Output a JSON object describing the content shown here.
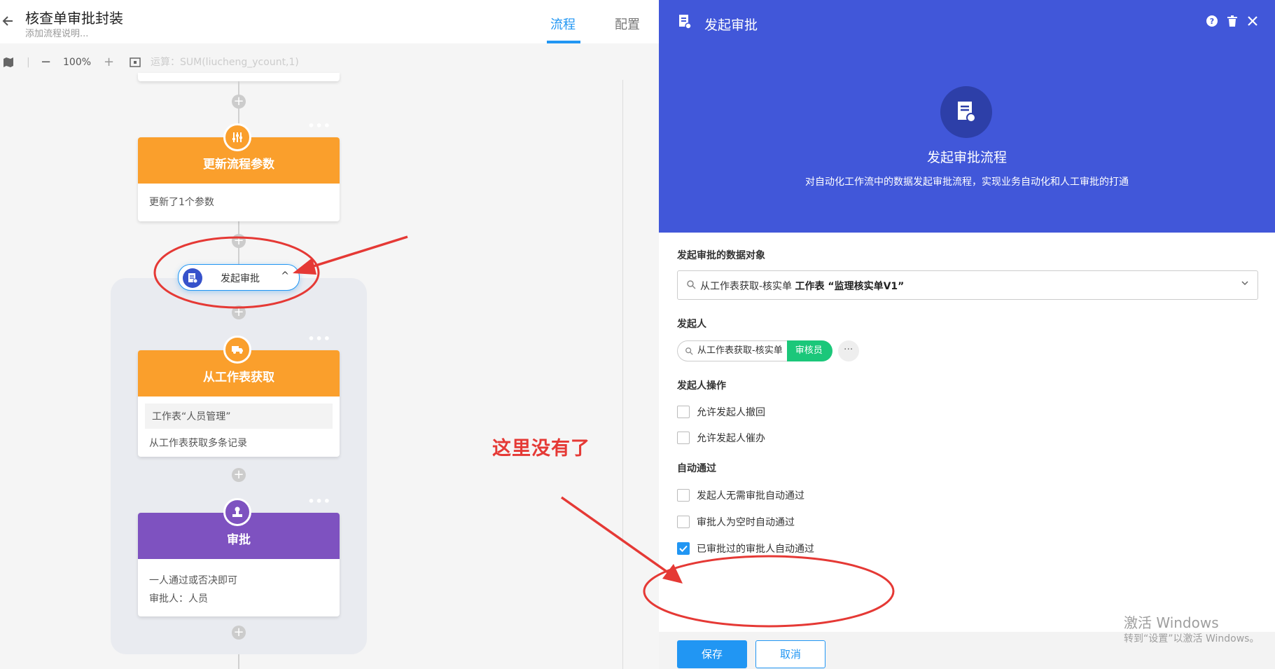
{
  "header": {
    "title": "核查单审批封装",
    "subtitle": "添加流程说明...",
    "tabs": [
      {
        "label": "流程"
      },
      {
        "label": "配置"
      }
    ]
  },
  "toolbar": {
    "zoom": "100%",
    "formula": "运算：SUM(liucheng_ycount,1)"
  },
  "nodes": {
    "update": {
      "title": "更新流程参数",
      "body": "更新了1个参数",
      "color": "#fa9f2c"
    },
    "approve_pill": {
      "label": "发起审批",
      "chevron": "^"
    },
    "fetch": {
      "title": "从工作表获取",
      "box": "工作表“人员管理”",
      "body": "从工作表获取多条记录",
      "color": "#fa9f2c"
    },
    "approval": {
      "title": "审批",
      "line1": "一人通过或否决即可",
      "line2": "审批人：人员",
      "color": "#7e52c0"
    }
  },
  "annotation": {
    "text": "这里没有了",
    "color": "#e53935"
  },
  "panel": {
    "title": "发起审批",
    "main_title": "发起审批流程",
    "description": "对自动化工作流中的数据发起审批流程，实现业务自动化和人工审批的打通",
    "header_color": "#4157d9",
    "data_object": {
      "label": "发起审批的数据对象",
      "value_prefix": "从工作表获取-核实单",
      "value_strong": "工作表 “监理核实单V1”"
    },
    "initiator": {
      "label": "发起人",
      "source": "从工作表获取-核实单",
      "field": "审核员",
      "more": "···"
    },
    "initiator_ops": {
      "label": "发起人操作",
      "options": [
        {
          "label": "允许发起人撤回",
          "checked": false
        },
        {
          "label": "允许发起人催办",
          "checked": false
        }
      ]
    },
    "auto_pass": {
      "label": "自动通过",
      "options": [
        {
          "label": "发起人无需审批自动通过",
          "checked": false
        },
        {
          "label": "审批人为空时自动通过",
          "checked": false
        },
        {
          "label": "已审批过的审批人自动通过",
          "checked": true
        }
      ]
    },
    "buttons": {
      "save": "保存",
      "cancel": "取消"
    }
  },
  "windows_watermark": {
    "line1": "激活 Windows",
    "line2": "转到“设置”以激活 Windows。"
  }
}
